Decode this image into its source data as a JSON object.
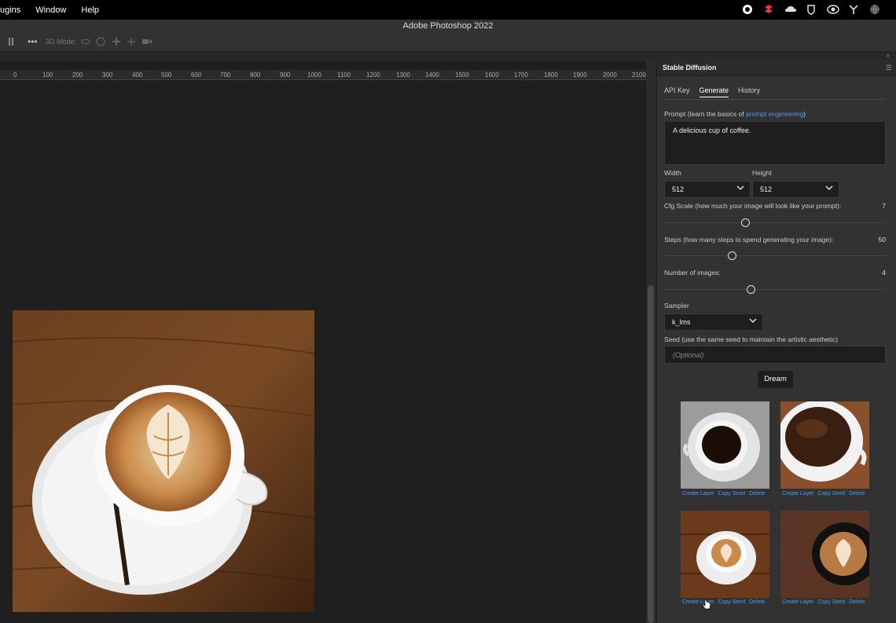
{
  "menubar": {
    "items": [
      "ugins",
      "Window",
      "Help"
    ]
  },
  "tray_icons": [
    "record-icon",
    "dropbox-icon",
    "cloud-icon",
    "shield-icon",
    "creative-cloud-icon",
    "fork-icon",
    "globe-icon"
  ],
  "app": {
    "title": "Adobe Photoshop 2022"
  },
  "options": {
    "mode_label": "3D Mode:"
  },
  "ruler": {
    "ticks": [
      "0",
      "100",
      "200",
      "300",
      "400",
      "500",
      "600",
      "700",
      "800",
      "900",
      "1000",
      "1100",
      "1200",
      "1300",
      "1400",
      "1500",
      "1600",
      "1700",
      "1800",
      "1900",
      "2000",
      "2100"
    ]
  },
  "panel": {
    "title": "Stable Diffusion",
    "tabs": [
      "API Key",
      "Generate",
      "History"
    ],
    "active_tab": "Generate",
    "prompt": {
      "label_prefix": "Prompt (learn the basics of ",
      "label_link": "prompt engineering",
      "label_suffix": ")",
      "value": "A delicious cup of coffee."
    },
    "width": {
      "label": "Width",
      "value": "512"
    },
    "height": {
      "label": "Height",
      "value": "512"
    },
    "cfg": {
      "label": "Cfg Scale (how much your image will look like your prompt):",
      "value": "7"
    },
    "steps": {
      "label": "Steps (how many steps to spend generating your image):",
      "value": "50"
    },
    "num_images": {
      "label": "Number of images:",
      "value": "4"
    },
    "sampler": {
      "label": "Sampler",
      "value": "k_lms"
    },
    "seed": {
      "label": "Seed (use the same seed to maintain the artistic aesthetic)",
      "placeholder": "(Optional)"
    },
    "dream_label": "Dream",
    "results": [
      {
        "create": "Create Layer",
        "copy": "Copy Seed",
        "delete": "Delete"
      },
      {
        "create": "Create Layer",
        "copy": "Copy Seed",
        "delete": "Delete"
      },
      {
        "create": "Create Layer",
        "copy": "Copy Seed",
        "delete": "Delete"
      },
      {
        "create": "Create Layer",
        "copy": "Copy Seed",
        "delete": "Delete"
      }
    ]
  }
}
